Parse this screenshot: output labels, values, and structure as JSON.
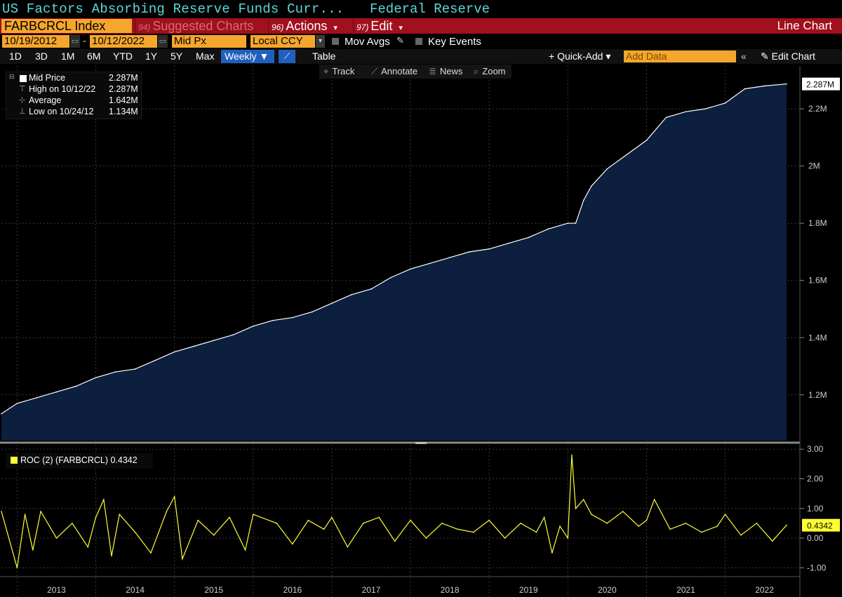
{
  "header": {
    "title": "US Factors Absorbing Reserve Funds Curr...",
    "source": "Federal Reserve"
  },
  "toolbar": {
    "ticker": "FARBCRCL Index",
    "suggested": {
      "num": "94)",
      "label": "Suggested Charts"
    },
    "actions": {
      "num": "96)",
      "label": "Actions",
      "caret": "▾"
    },
    "edit": {
      "num": "97)",
      "label": "Edit",
      "caret": "▾"
    },
    "chart_type": "Line Chart"
  },
  "range_bar": {
    "start_date": "10/19/2012",
    "end_date": "10/12/2022",
    "dash": "-",
    "price_field": "Mid Px",
    "currency": "Local CCY",
    "mov_avgs": "Mov Avgs",
    "key_events": "Key Events"
  },
  "periods": [
    "1D",
    "3D",
    "1M",
    "6M",
    "YTD",
    "1Y",
    "5Y",
    "Max"
  ],
  "frequency": "Weekly ▼",
  "table_label": "Table",
  "quick_add": "+ Quick-Add ▾",
  "add_data_placeholder": "Add Data",
  "collapse": "«",
  "edit_chart": "✎ Edit Chart",
  "tools": [
    "Track",
    "Annotate",
    "News",
    "Zoom"
  ],
  "legend": {
    "mid_price": {
      "label": "Mid Price",
      "value": "2.287M"
    },
    "high": {
      "label": "High on 10/12/22",
      "value": "2.287M"
    },
    "average": {
      "label": "Average",
      "value": "1.642M"
    },
    "low": {
      "label": "Low on 10/24/12",
      "value": "1.134M"
    }
  },
  "roc_legend": "ROC (2) (FARBCRCL) 0.4342",
  "colors": {
    "area_fill": "#0c1f3f",
    "line": "#ffffff",
    "roc_line": "#ffff33",
    "accent_orange": "#f5a62c",
    "menu_red": "#a0101d"
  },
  "chart_data": [
    {
      "type": "area",
      "series": [
        {
          "name": "Mid Price",
          "unit": "M"
        }
      ],
      "x": [
        2012.8,
        2013.0,
        2013.25,
        2013.5,
        2013.75,
        2014.0,
        2014.25,
        2014.5,
        2014.75,
        2015.0,
        2015.25,
        2015.5,
        2015.75,
        2016.0,
        2016.25,
        2016.5,
        2016.75,
        2017.0,
        2017.25,
        2017.5,
        2017.75,
        2018.0,
        2018.25,
        2018.5,
        2018.75,
        2019.0,
        2019.25,
        2019.5,
        2019.75,
        2020.0,
        2020.1,
        2020.2,
        2020.3,
        2020.5,
        2020.75,
        2021.0,
        2021.25,
        2021.5,
        2021.75,
        2022.0,
        2022.25,
        2022.5,
        2022.78
      ],
      "y": [
        1.134,
        1.17,
        1.19,
        1.21,
        1.23,
        1.26,
        1.28,
        1.29,
        1.32,
        1.35,
        1.37,
        1.39,
        1.41,
        1.44,
        1.46,
        1.47,
        1.49,
        1.52,
        1.55,
        1.57,
        1.61,
        1.64,
        1.66,
        1.68,
        1.7,
        1.71,
        1.73,
        1.75,
        1.78,
        1.8,
        1.8,
        1.88,
        1.93,
        1.99,
        2.04,
        2.09,
        2.17,
        2.19,
        2.2,
        2.22,
        2.27,
        2.28,
        2.287
      ],
      "ylim": [
        1.04,
        2.35
      ],
      "yticks": [
        {
          "v": 1.2,
          "label": "1.2M"
        },
        {
          "v": 1.4,
          "label": "1.4M"
        },
        {
          "v": 1.6,
          "label": "1.6M"
        },
        {
          "v": 1.8,
          "label": "1.8M"
        },
        {
          "v": 2.0,
          "label": "2M"
        },
        {
          "v": 2.2,
          "label": "2.2M"
        }
      ],
      "last_value_label": "2.287M",
      "grid": true
    },
    {
      "type": "line",
      "series": [
        {
          "name": "ROC (2) (FARBCRCL)"
        }
      ],
      "x": [
        2012.8,
        2013.0,
        2013.1,
        2013.2,
        2013.3,
        2013.5,
        2013.7,
        2013.9,
        2014.0,
        2014.1,
        2014.2,
        2014.3,
        2014.5,
        2014.7,
        2014.9,
        2015.0,
        2015.1,
        2015.3,
        2015.5,
        2015.7,
        2015.9,
        2016.0,
        2016.3,
        2016.5,
        2016.7,
        2016.9,
        2017.0,
        2017.2,
        2017.4,
        2017.6,
        2017.8,
        2018.0,
        2018.2,
        2018.4,
        2018.6,
        2018.8,
        2019.0,
        2019.2,
        2019.4,
        2019.6,
        2019.7,
        2019.8,
        2019.9,
        2020.0,
        2020.05,
        2020.1,
        2020.2,
        2020.3,
        2020.5,
        2020.7,
        2020.9,
        2021.0,
        2021.1,
        2021.3,
        2021.5,
        2021.7,
        2021.9,
        2022.0,
        2022.2,
        2022.4,
        2022.6,
        2022.78
      ],
      "y": [
        0.9,
        -1.0,
        0.8,
        -0.4,
        0.9,
        0.0,
        0.5,
        -0.3,
        0.7,
        1.3,
        -0.6,
        0.8,
        0.2,
        -0.5,
        0.9,
        1.4,
        -0.7,
        0.6,
        0.1,
        0.7,
        -0.4,
        0.8,
        0.5,
        -0.2,
        0.6,
        0.3,
        0.7,
        -0.3,
        0.5,
        0.7,
        -0.1,
        0.6,
        0.0,
        0.5,
        0.3,
        0.2,
        0.6,
        0.0,
        0.5,
        0.2,
        0.7,
        -0.5,
        0.4,
        0.0,
        2.8,
        1.0,
        1.3,
        0.8,
        0.5,
        0.9,
        0.4,
        0.6,
        1.3,
        0.3,
        0.5,
        0.2,
        0.4,
        0.8,
        0.1,
        0.5,
        -0.1,
        0.4342
      ],
      "ylim": [
        -1.3,
        3.1
      ],
      "yticks": [
        {
          "v": -1,
          "label": "-1.00"
        },
        {
          "v": 0,
          "label": "0.00"
        },
        {
          "v": 1,
          "label": "1.00"
        },
        {
          "v": 2,
          "label": "2.00"
        },
        {
          "v": 3,
          "label": "3.00"
        }
      ],
      "last_value_label": "0.4342",
      "grid": true
    }
  ],
  "x_axis": {
    "labels": [
      "2013",
      "2014",
      "2015",
      "2016",
      "2017",
      "2018",
      "2019",
      "2020",
      "2021",
      "2022"
    ],
    "range": [
      2012.8,
      2022.95
    ]
  }
}
